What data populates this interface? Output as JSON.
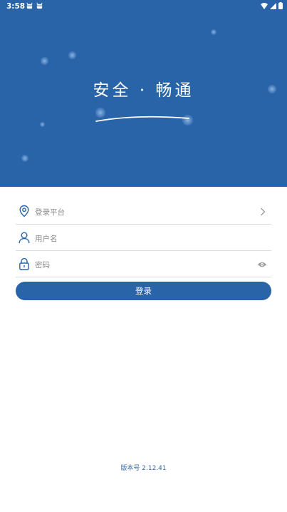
{
  "status_bar": {
    "time": "3:58",
    "notification_icons": [
      "bug-icon",
      "bug-icon"
    ],
    "system_icons": [
      "wifi-icon",
      "signal-icon",
      "battery-icon"
    ]
  },
  "hero": {
    "background_color": "#2a64a8",
    "title": "安全 · 畅通"
  },
  "form": {
    "platform": {
      "placeholder": "登录平台",
      "icon": "location-pin-icon",
      "trailing_icon": "chevron-right-icon"
    },
    "username": {
      "placeholder": "用户名",
      "icon": "user-icon"
    },
    "password": {
      "placeholder": "密码",
      "icon": "lock-icon",
      "trailing_icon": "eye-icon"
    },
    "submit_label": "登录"
  },
  "footer": {
    "version_label": "版本号 2.12.41"
  },
  "colors": {
    "primary": "#2a64a8",
    "divider": "#dcdcdc",
    "placeholder": "#8a8a8a"
  }
}
